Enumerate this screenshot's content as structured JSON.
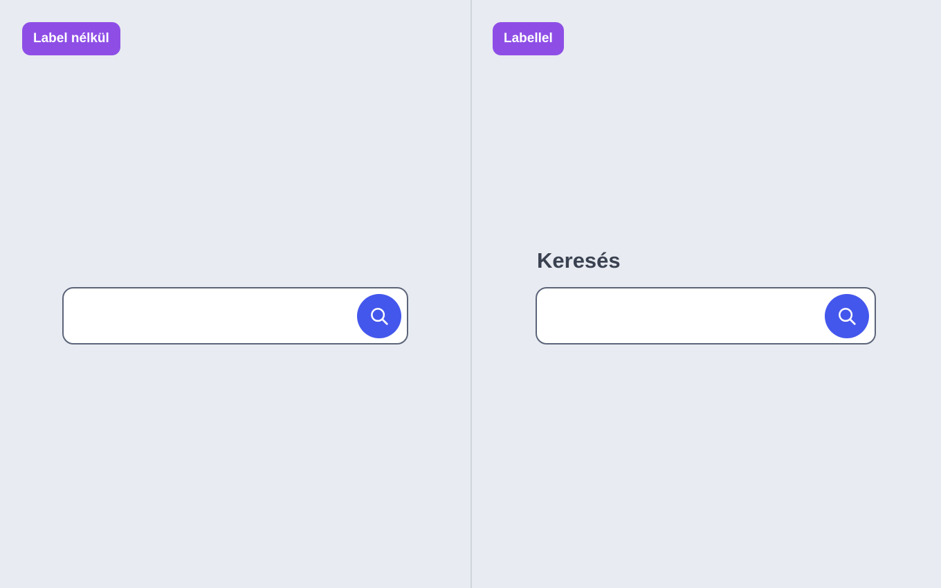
{
  "colors": {
    "background": "#e8ebf1",
    "tag_background": "#8e4ee6",
    "button_background": "#4457ec",
    "input_border": "#5b6478",
    "label_text": "#3a4150"
  },
  "left_panel": {
    "tag_label": "Label nélkül",
    "search": {
      "value": "",
      "placeholder": "",
      "button_icon": "search-icon"
    }
  },
  "right_panel": {
    "tag_label": "Labellel",
    "field_label": "Keresés",
    "search": {
      "value": "",
      "placeholder": "",
      "button_icon": "search-icon"
    }
  }
}
